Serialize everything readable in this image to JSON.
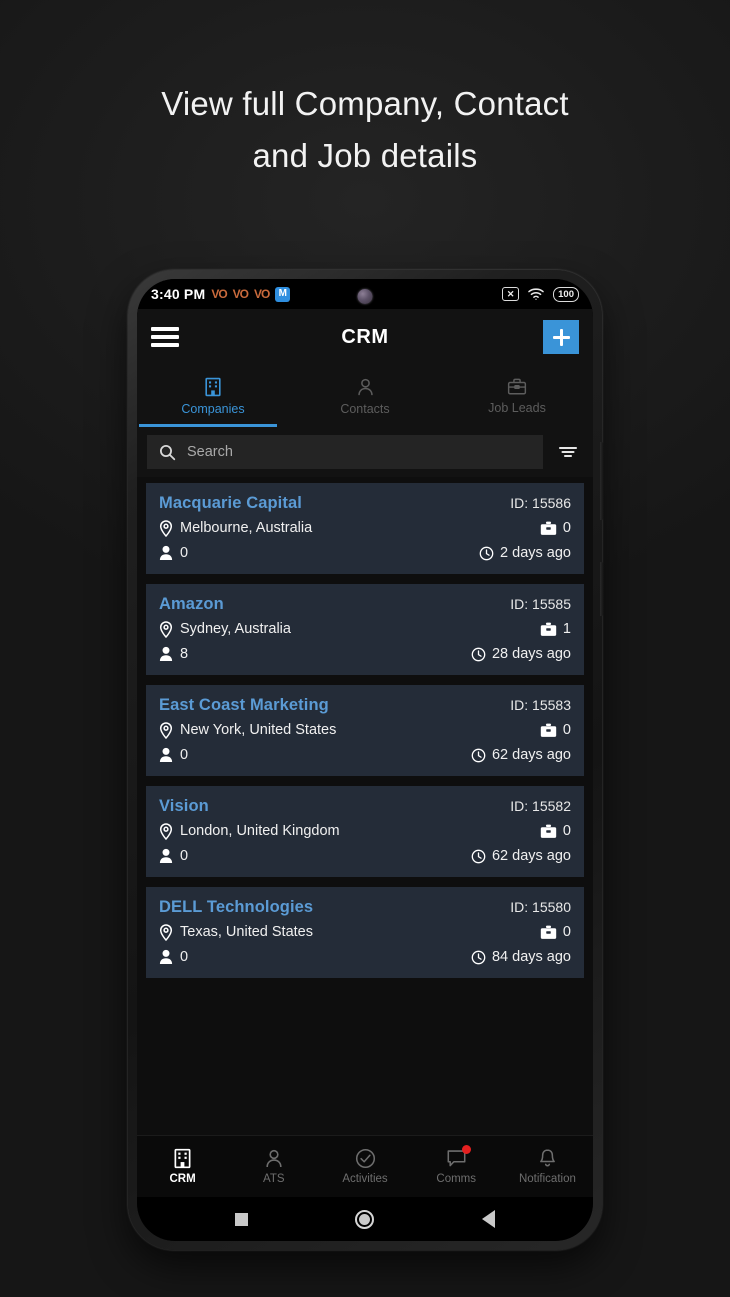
{
  "headline": {
    "line1": "View full Company, Contact",
    "line2": "and Job details"
  },
  "statusbar": {
    "time": "3:40 PM",
    "volte1": "VO",
    "volte2": "VO",
    "volte3": "VO",
    "app_badge": "M",
    "nosim_icon": "x-box-icon",
    "wifi_icon": "wifi-icon",
    "battery": "100"
  },
  "appbar": {
    "menu_icon": "hamburger-menu-icon",
    "title": "CRM",
    "add_icon": "plus-icon"
  },
  "tabs": [
    {
      "label": "Companies",
      "icon": "building-icon",
      "active": true
    },
    {
      "label": "Contacts",
      "icon": "person-icon",
      "active": false
    },
    {
      "label": "Job Leads",
      "icon": "briefcase-icon",
      "active": false
    }
  ],
  "search": {
    "placeholder": "Search",
    "value": "",
    "icon": "search-icon",
    "filter_icon": "filter-icon"
  },
  "companies": [
    {
      "name": "Macquarie Capital",
      "id_label": "ID: 15586",
      "location": "Melbourne, Australia",
      "contacts": "0",
      "jobs": "0",
      "updated": "2 days ago"
    },
    {
      "name": "Amazon",
      "id_label": "ID: 15585",
      "location": "Sydney, Australia",
      "contacts": "8",
      "jobs": "1",
      "updated": "28 days ago"
    },
    {
      "name": "East Coast Marketing",
      "id_label": "ID: 15583",
      "location": "New York, United States",
      "contacts": "0",
      "jobs": "0",
      "updated": "62 days ago"
    },
    {
      "name": "Vision",
      "id_label": "ID: 15582",
      "location": "London, United Kingdom",
      "contacts": "0",
      "jobs": "0",
      "updated": "62 days ago"
    },
    {
      "name": "DELL Technologies",
      "id_label": "ID: 15580",
      "location": "Texas, United States",
      "contacts": "0",
      "jobs": "0",
      "updated": "84 days ago"
    }
  ],
  "bottomnav": [
    {
      "label": "CRM",
      "icon": "building-icon",
      "active": true,
      "badge": false
    },
    {
      "label": "ATS",
      "icon": "person-icon",
      "active": false,
      "badge": false
    },
    {
      "label": "Activities",
      "icon": "check-circle-icon",
      "active": false,
      "badge": false
    },
    {
      "label": "Comms",
      "icon": "chat-bubble-icon",
      "active": false,
      "badge": true
    },
    {
      "label": "Notification",
      "icon": "bell-icon",
      "active": false,
      "badge": false
    }
  ],
  "androidnav": {
    "recents_icon": "square-icon",
    "home_icon": "circle-icon",
    "back_icon": "triangle-back-icon"
  },
  "colors": {
    "accent": "#3a94d8",
    "link": "#5b9bd5",
    "card_bg": "#242c38",
    "screen_bg": "#121212",
    "badge": "#e52020"
  }
}
